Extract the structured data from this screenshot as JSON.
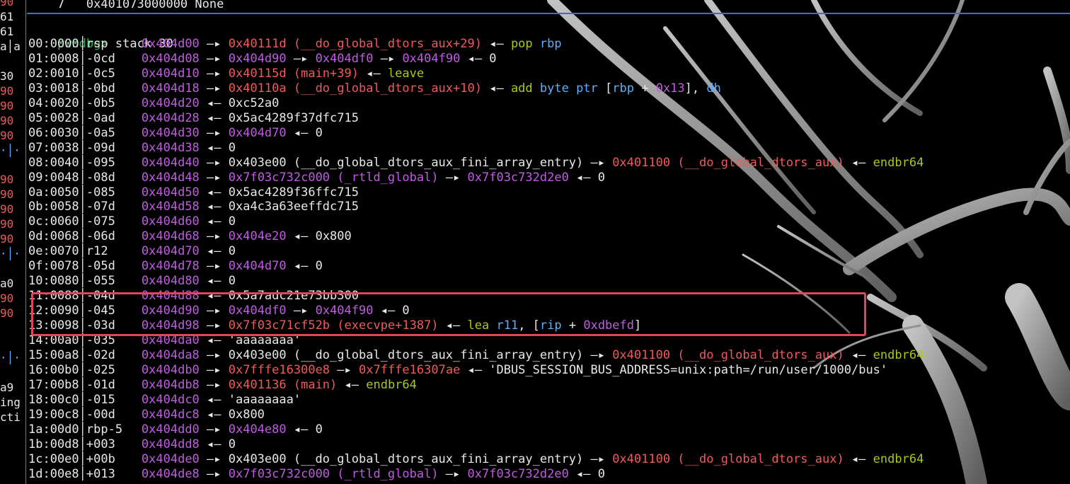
{
  "terminal": {
    "header": "    7   0x401073000000 None",
    "prompt": "pwndbg>",
    "command": "stack 30",
    "accent_colors": {
      "address": "#c05ce2",
      "code": "#ef5a5a",
      "register": "#5ab0ff",
      "keyword": "#a8c81a",
      "prompt": "#23b04a",
      "highlight_border": "#e0455a",
      "separator": "#3b6fcf"
    }
  },
  "gutter": [
    "90",
    "61",
    "61",
    "a│a",
    "",
    "30",
    "90",
    "90",
    "90",
    "90",
    "·│·",
    "",
    "90",
    "90",
    "90",
    "90",
    "90",
    "·│·",
    "",
    "a0",
    "90",
    "90",
    "",
    "",
    "·│·",
    "",
    "a9",
    "ing",
    "cti",
    ""
  ],
  "stack": [
    {
      "idx": "00:0000",
      "off": "rsp",
      "parts": [
        [
          "a",
          "0x404d00"
        ],
        [
          "w",
          " —▸ "
        ],
        [
          "c",
          "0x40111d (__do_global_dtors_aux+29)"
        ],
        [
          "w",
          " ◂— "
        ],
        [
          "k",
          "pop "
        ],
        [
          "r",
          "rbp"
        ]
      ]
    },
    {
      "idx": "01:0008",
      "off": "-0cd",
      "parts": [
        [
          "a",
          "0x404d08"
        ],
        [
          "w",
          " —▸ "
        ],
        [
          "a",
          "0x404d90"
        ],
        [
          "w",
          " —▸ "
        ],
        [
          "a",
          "0x404df0"
        ],
        [
          "w",
          " —▸ "
        ],
        [
          "a",
          "0x404f90"
        ],
        [
          "w",
          " ◂— 0"
        ]
      ]
    },
    {
      "idx": "02:0010",
      "off": "-0c5",
      "parts": [
        [
          "a",
          "0x404d10"
        ],
        [
          "w",
          " —▸ "
        ],
        [
          "c",
          "0x40115d (main+39)"
        ],
        [
          "w",
          " ◂— "
        ],
        [
          "k",
          "leave"
        ]
      ]
    },
    {
      "idx": "03:0018",
      "off": "-0bd",
      "parts": [
        [
          "a",
          "0x404d18"
        ],
        [
          "w",
          " —▸ "
        ],
        [
          "c",
          "0x40110a (__do_global_dtors_aux+10)"
        ],
        [
          "w",
          " ◂— "
        ],
        [
          "k",
          "add "
        ],
        [
          "r",
          "byte ptr "
        ],
        [
          "w",
          "["
        ],
        [
          "r",
          "rbp"
        ],
        [
          "w",
          " + "
        ],
        [
          "a",
          "0x13"
        ],
        [
          "w",
          "], "
        ],
        [
          "r",
          "dh"
        ]
      ]
    },
    {
      "idx": "04:0020",
      "off": "-0b5",
      "parts": [
        [
          "a",
          "0x404d20"
        ],
        [
          "w",
          " ◂— 0xc52a0"
        ]
      ]
    },
    {
      "idx": "05:0028",
      "off": "-0ad",
      "parts": [
        [
          "a",
          "0x404d28"
        ],
        [
          "w",
          " ◂— 0x5ac4289f37dfc715"
        ]
      ]
    },
    {
      "idx": "06:0030",
      "off": "-0a5",
      "parts": [
        [
          "a",
          "0x404d30"
        ],
        [
          "w",
          " —▸ "
        ],
        [
          "a",
          "0x404d70"
        ],
        [
          "w",
          " ◂— 0"
        ]
      ]
    },
    {
      "idx": "07:0038",
      "off": "-09d",
      "parts": [
        [
          "a",
          "0x404d38"
        ],
        [
          "w",
          " ◂— 0"
        ]
      ]
    },
    {
      "idx": "08:0040",
      "off": "-095",
      "parts": [
        [
          "a",
          "0x404d40"
        ],
        [
          "w",
          " —▸ 0x403e00 (__do_global_dtors_aux_fini_array_entry) —▸ "
        ],
        [
          "c",
          "0x401100 (__do_global_dtors_aux)"
        ],
        [
          "w",
          " ◂— "
        ],
        [
          "k",
          "endbr64"
        ]
      ]
    },
    {
      "idx": "09:0048",
      "off": "-08d",
      "parts": [
        [
          "a",
          "0x404d48"
        ],
        [
          "w",
          " —▸ "
        ],
        [
          "a",
          "0x7f03c732c000 (_rtld_global)"
        ],
        [
          "w",
          " —▸ "
        ],
        [
          "a",
          "0x7f03c732d2e0"
        ],
        [
          "w",
          " ◂— 0"
        ]
      ]
    },
    {
      "idx": "0a:0050",
      "off": "-085",
      "parts": [
        [
          "a",
          "0x404d50"
        ],
        [
          "w",
          " ◂— 0x5ac4289f36ffc715"
        ]
      ]
    },
    {
      "idx": "0b:0058",
      "off": "-07d",
      "parts": [
        [
          "a",
          "0x404d58"
        ],
        [
          "w",
          " ◂— 0xa4c3a63eeffdc715"
        ]
      ]
    },
    {
      "idx": "0c:0060",
      "off": "-075",
      "parts": [
        [
          "a",
          "0x404d60"
        ],
        [
          "w",
          " ◂— 0"
        ]
      ]
    },
    {
      "idx": "0d:0068",
      "off": "-06d",
      "parts": [
        [
          "a",
          "0x404d68"
        ],
        [
          "w",
          " —▸ "
        ],
        [
          "a",
          "0x404e20"
        ],
        [
          "w",
          " ◂— 0x800"
        ]
      ]
    },
    {
      "idx": "0e:0070",
      "off": "r12",
      "parts": [
        [
          "a",
          "0x404d70"
        ],
        [
          "w",
          " ◂— 0"
        ]
      ]
    },
    {
      "idx": "0f:0078",
      "off": "-05d",
      "parts": [
        [
          "a",
          "0x404d78"
        ],
        [
          "w",
          " —▸ "
        ],
        [
          "a",
          "0x404d70"
        ],
        [
          "w",
          " ◂— 0"
        ]
      ]
    },
    {
      "idx": "10:0080",
      "off": "-055",
      "parts": [
        [
          "a",
          "0x404d80"
        ],
        [
          "w",
          " ◂— 0"
        ]
      ]
    },
    {
      "idx": "11:0088",
      "off": "-04d",
      "parts": [
        [
          "a",
          "0x404d88"
        ],
        [
          "w",
          " ◂— 0x5a7adc21e73bb300"
        ]
      ]
    },
    {
      "idx": "12:0090",
      "off": "-045",
      "parts": [
        [
          "a",
          "0x404d90"
        ],
        [
          "w",
          " —▸ "
        ],
        [
          "a",
          "0x404df0"
        ],
        [
          "w",
          " —▸ "
        ],
        [
          "a",
          "0x404f90"
        ],
        [
          "w",
          " ◂— 0"
        ]
      ]
    },
    {
      "idx": "13:0098",
      "off": "-03d",
      "parts": [
        [
          "a",
          "0x404d98"
        ],
        [
          "w",
          " —▸ "
        ],
        [
          "c",
          "0x7f03c71cf52b (execvpe+1387)"
        ],
        [
          "w",
          " ◂— "
        ],
        [
          "k",
          "lea "
        ],
        [
          "r",
          "r11"
        ],
        [
          "w",
          ", ["
        ],
        [
          "r",
          "rip"
        ],
        [
          "w",
          " + "
        ],
        [
          "a",
          "0xdbefd"
        ],
        [
          "w",
          "]"
        ]
      ]
    },
    {
      "idx": "14:00a0",
      "off": "-035",
      "parts": [
        [
          "a",
          "0x404da0"
        ],
        [
          "w",
          " ◂— 'aaaaaaaa'"
        ]
      ]
    },
    {
      "idx": "15:00a8",
      "off": "-02d",
      "parts": [
        [
          "a",
          "0x404da8"
        ],
        [
          "w",
          " —▸ 0x403e00 (__do_global_dtors_aux_fini_array_entry) —▸ "
        ],
        [
          "c",
          "0x401100 (__do_global_dtors_aux)"
        ],
        [
          "w",
          " ◂— "
        ],
        [
          "k",
          "endbr64"
        ]
      ]
    },
    {
      "idx": "16:00b0",
      "off": "-025",
      "parts": [
        [
          "a",
          "0x404db0"
        ],
        [
          "w",
          " —▸ "
        ],
        [
          "c",
          "0x7fffe16300e8"
        ],
        [
          "w",
          " —▸ "
        ],
        [
          "c",
          "0x7fffe16307ae"
        ],
        [
          "w",
          " ◂— 'DBUS_SESSION_BUS_ADDRESS=unix:path=/run/user/1000/bus'"
        ]
      ]
    },
    {
      "idx": "17:00b8",
      "off": "-01d",
      "parts": [
        [
          "a",
          "0x404db8"
        ],
        [
          "w",
          " —▸ "
        ],
        [
          "c",
          "0x401136 (main)"
        ],
        [
          "w",
          " ◂— "
        ],
        [
          "k",
          "endbr64"
        ]
      ]
    },
    {
      "idx": "18:00c0",
      "off": "-015",
      "parts": [
        [
          "a",
          "0x404dc0"
        ],
        [
          "w",
          " ◂— 'aaaaaaaa'"
        ]
      ]
    },
    {
      "idx": "19:00c8",
      "off": "-00d",
      "parts": [
        [
          "a",
          "0x404dc8"
        ],
        [
          "w",
          " ◂— 0x800"
        ]
      ]
    },
    {
      "idx": "1a:00d0",
      "off": "rbp-5",
      "parts": [
        [
          "a",
          "0x404dd0"
        ],
        [
          "w",
          " —▸ "
        ],
        [
          "a",
          "0x404e80"
        ],
        [
          "w",
          " ◂— 0"
        ]
      ]
    },
    {
      "idx": "1b:00d8",
      "off": "+003",
      "parts": [
        [
          "a",
          "0x404dd8"
        ],
        [
          "w",
          " ◂— 0"
        ]
      ]
    },
    {
      "idx": "1c:00e0",
      "off": "+00b",
      "parts": [
        [
          "a",
          "0x404de0"
        ],
        [
          "w",
          " —▸ 0x403e00 (__do_global_dtors_aux_fini_array_entry) —▸ "
        ],
        [
          "c",
          "0x401100 (__do_global_dtors_aux)"
        ],
        [
          "w",
          " ◂— "
        ],
        [
          "k",
          "endbr64"
        ]
      ]
    },
    {
      "idx": "1d:00e8",
      "off": "+013",
      "parts": [
        [
          "a",
          "0x404de8"
        ],
        [
          "w",
          " —▸ "
        ],
        [
          "a",
          "0x7f03c732c000 (_rtld_global)"
        ],
        [
          "w",
          " —▸ "
        ],
        [
          "a",
          "0x7f03c732d2e0"
        ],
        [
          "w",
          " ◂— 0"
        ]
      ]
    }
  ]
}
